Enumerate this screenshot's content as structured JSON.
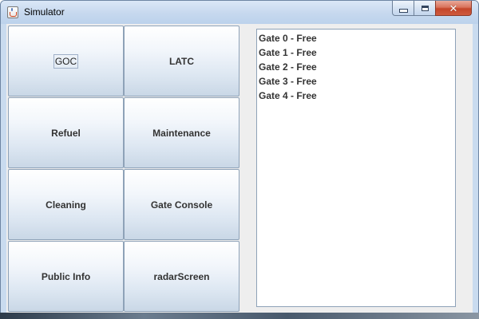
{
  "window": {
    "title": "Simulator",
    "icon": "java-cup-icon",
    "controls": {
      "minimize": "minimize-icon",
      "maximize": "maximize-icon",
      "close": "✕"
    }
  },
  "buttons": [
    {
      "label": "GOC",
      "focused": true
    },
    {
      "label": "LATC"
    },
    {
      "label": "Refuel"
    },
    {
      "label": "Maintenance"
    },
    {
      "label": "Cleaning"
    },
    {
      "label": "Gate Console"
    },
    {
      "label": "Public Info"
    },
    {
      "label": "radarScreen"
    }
  ],
  "gates": [
    "Gate 0 - Free",
    "Gate 1 - Free",
    "Gate 2 - Free",
    "Gate 3 - Free",
    "Gate 4 - Free"
  ],
  "colors": {
    "title_bar": "#c6d8ee",
    "content_bg": "#eeeeee",
    "close_button": "#c4462a"
  }
}
